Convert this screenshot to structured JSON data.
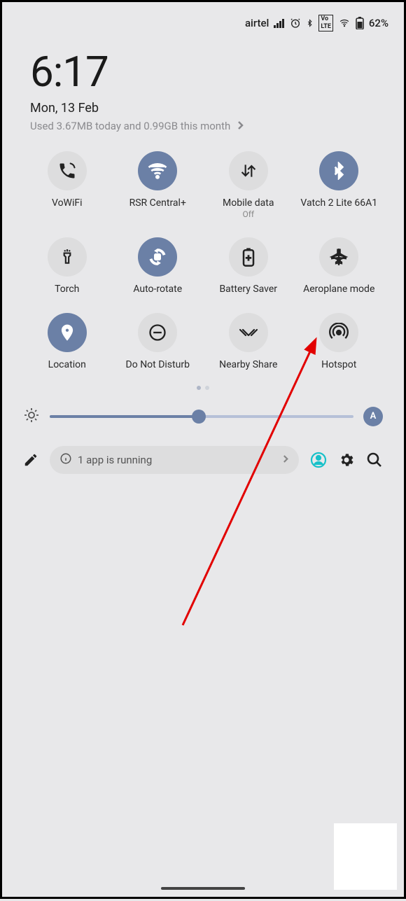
{
  "status": {
    "carrier": "airtel",
    "battery": "62%"
  },
  "clock": "6:17",
  "date": "Mon, 13 Feb",
  "usage": "Used 3.67MB today and 0.99GB this month",
  "tiles": [
    {
      "label": "VoWiFi",
      "sublabel": "",
      "active": false,
      "icon": "call"
    },
    {
      "label": "RSR Central+",
      "sublabel": "",
      "active": true,
      "icon": "wifi"
    },
    {
      "label": "Mobile data",
      "sublabel": "Off",
      "active": false,
      "icon": "data"
    },
    {
      "label": "Vatch 2 Lite 66A1",
      "sublabel": "",
      "active": true,
      "icon": "bluetooth"
    },
    {
      "label": "Torch",
      "sublabel": "",
      "active": false,
      "icon": "torch"
    },
    {
      "label": "Auto-rotate",
      "sublabel": "",
      "active": true,
      "icon": "rotate"
    },
    {
      "label": "Battery Saver",
      "sublabel": "",
      "active": false,
      "icon": "battery"
    },
    {
      "label": "Aeroplane mode",
      "sublabel": "",
      "active": false,
      "icon": "plane"
    },
    {
      "label": "Location",
      "sublabel": "",
      "active": true,
      "icon": "location"
    },
    {
      "label": "Do Not Disturb",
      "sublabel": "",
      "active": false,
      "icon": "dnd"
    },
    {
      "label": "Nearby Share",
      "sublabel": "",
      "active": false,
      "icon": "share"
    },
    {
      "label": "Hotspot",
      "sublabel": "",
      "active": false,
      "icon": "hotspot"
    }
  ],
  "brightness": {
    "percent": 49,
    "auto_label": "A"
  },
  "running": "1 app is running",
  "colors": {
    "accent": "#6b80a6",
    "teal": "#18c1c9"
  }
}
